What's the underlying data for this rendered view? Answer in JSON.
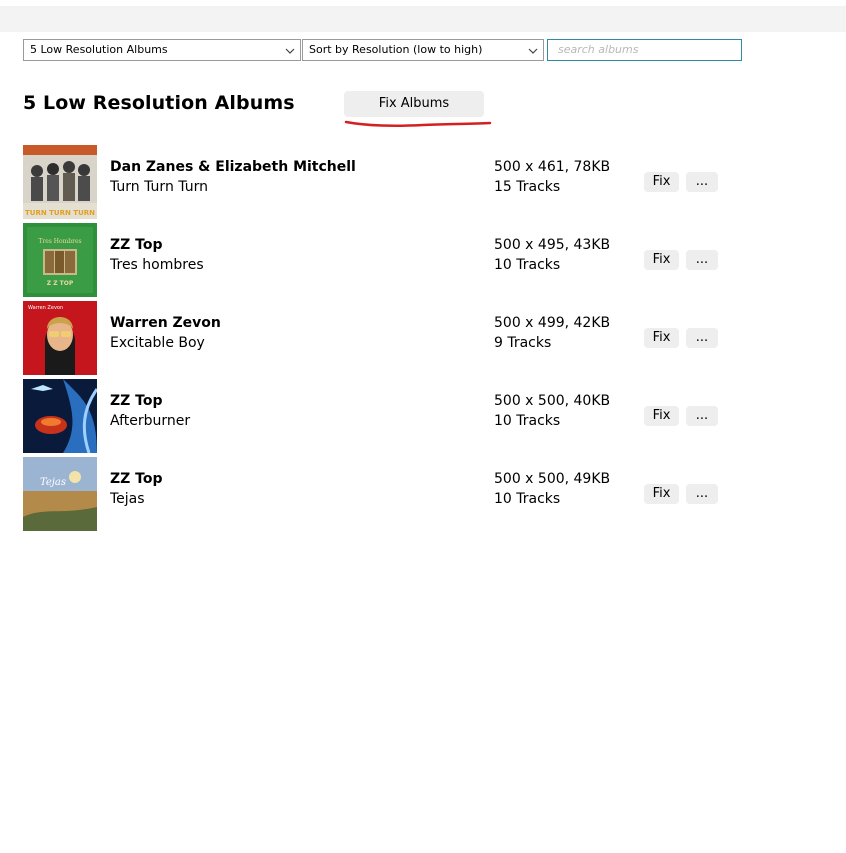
{
  "toolbar": {
    "filter_value": "5 Low Resolution Albums",
    "sort_value": "Sort by Resolution (low to high)",
    "search_placeholder": "search albums"
  },
  "header": {
    "title": "5 Low Resolution Albums",
    "fix_albums_label": "Fix Albums"
  },
  "row_buttons": {
    "fix_label": "Fix",
    "more_label": "..."
  },
  "albums": [
    {
      "artist": "Dan Zanes & Elizabeth Mitchell",
      "album": "Turn Turn Turn",
      "resolution": "500 x 461, 78KB",
      "tracks": "15 Tracks",
      "cover_text": "TURN TURN TURN"
    },
    {
      "artist": "ZZ Top",
      "album": "Tres hombres",
      "resolution": "500 x 495, 43KB",
      "tracks": "10 Tracks",
      "cover_text": "Z Z TOP"
    },
    {
      "artist": "Warren Zevon",
      "album": "Excitable Boy",
      "resolution": "500 x 499, 42KB",
      "tracks": "9 Tracks",
      "cover_text": "Warren Zevon"
    },
    {
      "artist": "ZZ Top",
      "album": "Afterburner",
      "resolution": "500 x 500, 40KB",
      "tracks": "10 Tracks",
      "cover_text": ""
    },
    {
      "artist": "ZZ Top",
      "album": "Tejas",
      "resolution": "500 x 500, 49KB",
      "tracks": "10 Tracks",
      "cover_text": "Tejas"
    }
  ],
  "colors": {
    "search_border": "#2f8aa6",
    "annotation_underline": "#d42020",
    "button_bg": "#eeeeee"
  }
}
